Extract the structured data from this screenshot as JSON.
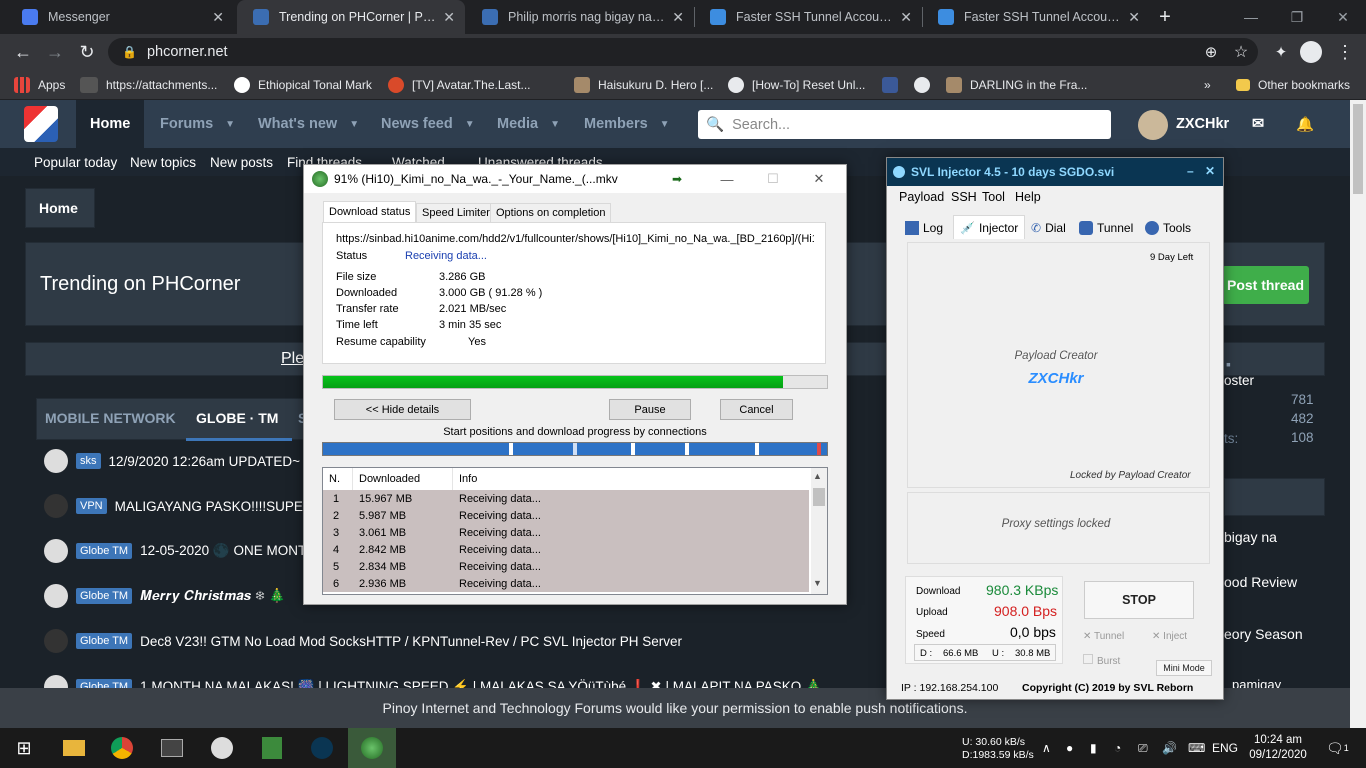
{
  "browser": {
    "tabs": [
      {
        "title": "Messenger",
        "color": "#4a7bf0"
      },
      {
        "title": "Trending on PHCorner | Pinoy Internet",
        "color": "#3b6db2"
      },
      {
        "title": "Philip morris nag bigay na | Pinoy",
        "color": "#3b6db2"
      },
      {
        "title": "Faster SSH Tunnel Accounts and",
        "color": "#3d8de0"
      },
      {
        "title": "Faster SSH Tunnel Accounts and",
        "color": "#3d8de0"
      }
    ],
    "new_tab": "+",
    "url": "phcorner.net",
    "bookmarks": [
      "Apps",
      "https://attachments...",
      "Ethiopical Tonal Mark",
      "[TV] Avatar.The.Last...",
      "Haisukuru D. Hero [...",
      "[How-To] Reset Unl...",
      "",
      "DARLING in the Fra...",
      "»",
      "Other bookmarks"
    ]
  },
  "site": {
    "nav": [
      "Home",
      "Forums",
      "What's new",
      "News feed",
      "Media",
      "Members"
    ],
    "search_placeholder": "Search...",
    "user": "ZXCHkr",
    "subnav": [
      "Popular today",
      "New topics",
      "New posts",
      "Find threads",
      "Watched",
      "Unanswered threads"
    ],
    "breadcrumb": "Home",
    "page_title": "Trending on PHCorner",
    "post_thread": "Post thread",
    "ple": "Ple",
    "tabs": [
      "MOBILE NETWORK",
      "GLOBE · TM",
      "S"
    ],
    "threads": [
      {
        "label": "sks",
        "text": "12/9/2020 12:26am UPDATED~"
      },
      {
        "label": "VPN",
        "text": "MALIGAYANG PASKO!!!!SUPE"
      },
      {
        "label": "Globe TM",
        "text": "12-05-2020 🌑 ONE MONT"
      },
      {
        "label": "Globe TM",
        "text": "𝑴𝒆𝒓𝒓𝒚 𝑪𝒉𝒓𝒊𝒔𝒕𝒎𝒂𝒔 ❄ 🎄"
      },
      {
        "label": "Globe TM",
        "text": "Dec8 V23!! GTM No Load Mod SocksHTTP / KPNTunnel-Rev / PC SVL Injector PH Server"
      },
      {
        "label": "Globe TM",
        "text": "1 MONTH NA MALAKAS! 🎆 | LIGHTNING SPEED ⚡ | MALAKAS SA YÖüTùbé ❗ ✖ | MALAPIT NA PASKO 🎄"
      }
    ],
    "right_stats": {
      "poster": "oster",
      "v1": "781",
      "v2": "482",
      "v3": "108",
      "stat3_label": "ts:"
    },
    "right_threads": [
      "bigay na",
      "ood Review",
      "eory Season",
      "pamigay"
    ],
    "push": "Pinoy Internet and Technology Forums would like your permission to enable push notifications."
  },
  "idm": {
    "title": "91% (Hi10)_Kimi_no_Na_wa._-_Your_Name._(...mkv",
    "tabs": [
      "Download status",
      "Speed Limiter",
      "Options on completion"
    ],
    "url": "https://sinbad.hi10anime.com/hdd2/v1/fullcounter/shows/[Hi10]_Kimi_no_Na_wa._[BD_2160p]/(Hi10)_Kimi_no",
    "status_label": "Status",
    "status": "Receiving data...",
    "file_size_label": "File size",
    "file_size": "3.286  GB",
    "downloaded_label": "Downloaded",
    "downloaded": "3.000  GB  ( 91.28 % )",
    "rate_label": "Transfer rate",
    "rate": "2.021  MB/sec",
    "time_label": "Time left",
    "time": "3 min 35 sec",
    "resume_label": "Resume capability",
    "resume": "Yes",
    "progress": 0.9128,
    "hide": "<< Hide details",
    "pause": "Pause",
    "cancel": "Cancel",
    "conn_caption": "Start positions and download progress by connections",
    "headers": [
      "N.",
      "Downloaded",
      "Info"
    ],
    "rows": [
      [
        "1",
        "15.967  MB",
        "Receiving data..."
      ],
      [
        "2",
        "5.987  MB",
        "Receiving data..."
      ],
      [
        "3",
        "3.061  MB",
        "Receiving data..."
      ],
      [
        "4",
        "2.842  MB",
        "Receiving data..."
      ],
      [
        "5",
        "2.834  MB",
        "Receiving data..."
      ],
      [
        "6",
        "2.936  MB",
        "Receiving data..."
      ]
    ]
  },
  "svl": {
    "title": "SVL Injector 4.5 - 10 days SGDO.svi",
    "menu": [
      "Payload",
      "SSH",
      "Tool",
      "Help"
    ],
    "tabs": [
      "Log",
      "Injector",
      "Dial",
      "Tunnel",
      "Tools"
    ],
    "days_left": "9 Day Left",
    "creator_label": "Payload Creator",
    "creator": "ZXCHkr",
    "locked": "Locked by Payload Creator",
    "proxy": "Proxy settings locked",
    "download_label": "Download",
    "download": "980.3 KBps",
    "upload_label": "Upload",
    "upload": "908.0 Bps",
    "speed_label": "Speed",
    "speed": "0,0 bps",
    "d_label": "D :",
    "d": "66.6 MB",
    "u_label": "U :",
    "u": "30.8 MB",
    "stop": "STOP",
    "tunnel": "Tunnel",
    "inject": "Inject",
    "burst": "Burst",
    "mini": "Mini Mode",
    "ip": "IP : 192.168.254.100",
    "copyright": "Copyright (C) 2019 by SVL Reborn"
  },
  "taskbar": {
    "net_u": "U:    30.60 kB/s",
    "net_d": "D:1983.59 kB/s",
    "lang": "ENG",
    "time": "10:24 am",
    "date": "09/12/2020",
    "notif": "1"
  }
}
